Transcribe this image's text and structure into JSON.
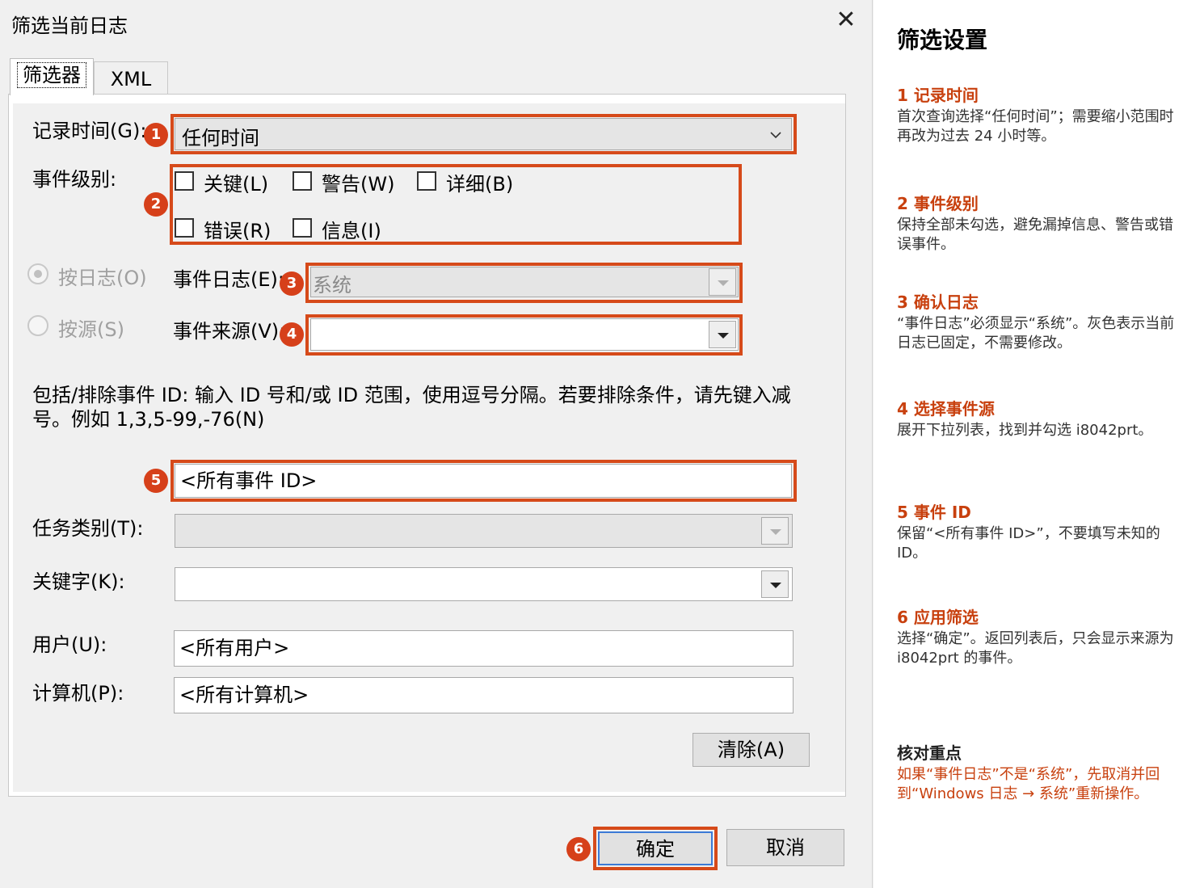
{
  "dialog": {
    "title": "筛选当前日志",
    "close_glyph": "✕",
    "tabs": [
      {
        "label": "筛选器"
      },
      {
        "label": "XML"
      }
    ],
    "record_time": {
      "label": "记录时间(G):",
      "value": "任何时间"
    },
    "event_level": {
      "label": "事件级别:",
      "options": [
        {
          "label": "关键(L)",
          "checked": false
        },
        {
          "label": "警告(W)",
          "checked": false
        },
        {
          "label": "详细(B)",
          "checked": false
        },
        {
          "label": "错误(R)",
          "checked": false
        },
        {
          "label": "信息(I)",
          "checked": false
        }
      ]
    },
    "by_log": {
      "label": "按日志(O)",
      "selected": true
    },
    "by_source": {
      "label": "按源(S)",
      "selected": false
    },
    "event_log": {
      "label": "事件日志(E):",
      "value": "系统"
    },
    "event_source": {
      "label": "事件来源(V):",
      "value": ""
    },
    "event_id_hint": "包括/排除事件 ID: 输入 ID 号和/或 ID 范围，使用逗号分隔。若要排除条件，请先键入减号。例如 1,3,5-99,-76(N)",
    "event_id": {
      "value": "<所有事件 ID>"
    },
    "task_category": {
      "label": "任务类别(T):",
      "value": ""
    },
    "keywords": {
      "label": "关键字(K):",
      "value": ""
    },
    "user": {
      "label": "用户(U):",
      "value": "<所有用户>"
    },
    "computer": {
      "label": "计算机(P):",
      "value": "<所有计算机>"
    },
    "clear_button": "清除(A)",
    "ok_button": "确定",
    "cancel_button": "取消",
    "badges": [
      "1",
      "2",
      "3",
      "4",
      "5",
      "6"
    ]
  },
  "side": {
    "title": "筛选设置",
    "steps": [
      {
        "heading": "1  记录时间",
        "text": "首次查询选择“任何时间”；需要缩小范围时再改为过去 24 小时等。"
      },
      {
        "heading": "2  事件级别",
        "text": "保持全部未勾选，避免漏掉信息、警告或错误事件。"
      },
      {
        "heading": "3  确认日志",
        "text": "“事件日志”必须显示“系统”。灰色表示当前日志已固定，不需要修改。"
      },
      {
        "heading": "4  选择事件源",
        "text": "展开下拉列表，找到并勾选 i8042prt。"
      },
      {
        "heading": "5  事件 ID",
        "text": "保留“<所有事件 ID>”，不要填写未知的 ID。"
      },
      {
        "heading": "6  应用筛选",
        "text": "选择“确定”。返回列表后，只会显示来源为 i8042prt 的事件。"
      }
    ],
    "note": {
      "heading": "核对重点",
      "text": "如果“事件日志”不是“系统”，先取消并回到“Windows 日志 → 系统”重新操作。"
    }
  },
  "colors": {
    "accent": "#d6401a",
    "step_heading": "#c8400e"
  }
}
